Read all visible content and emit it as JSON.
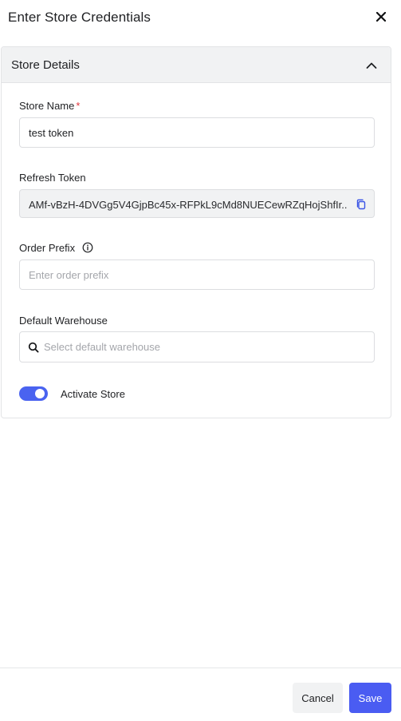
{
  "header": {
    "title": "Enter Store Credentials",
    "close_icon": "close-icon"
  },
  "section": {
    "title": "Store Details",
    "expanded": true,
    "chevron_icon": "chevron-up-icon"
  },
  "fields": {
    "store_name": {
      "label": "Store Name",
      "required_mark": "*",
      "value": "test token"
    },
    "refresh_token": {
      "label": "Refresh Token",
      "value": "AMf-vBzH-4DVGg5V4GjpBc45x-RFPkL9cMd8NUECewRZqHojShfIr...",
      "copy_icon": "copy-icon"
    },
    "order_prefix": {
      "label": "Order Prefix",
      "info_icon": "info-icon",
      "value": "",
      "placeholder": "Enter order prefix"
    },
    "default_warehouse": {
      "label": "Default Warehouse",
      "search_icon": "search-icon",
      "value": "",
      "placeholder": "Select default warehouse"
    },
    "activate_store": {
      "label": "Activate Store",
      "enabled": true
    }
  },
  "footer": {
    "cancel_label": "Cancel",
    "save_label": "Save"
  },
  "colors": {
    "accent": "#4a5cf2",
    "toggle_on": "#4a63f0",
    "required": "#e0353b",
    "section_header_bg": "#f1f2f3"
  }
}
